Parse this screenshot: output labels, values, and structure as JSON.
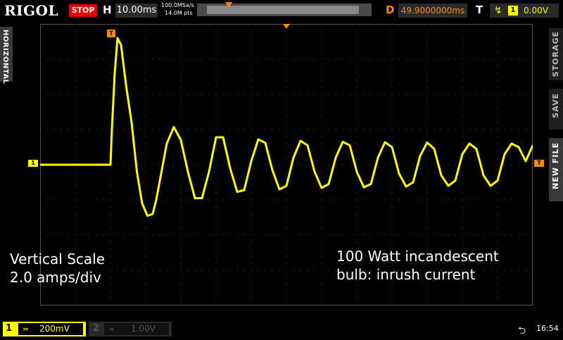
{
  "header": {
    "brand": "RIGOL",
    "run_state": "STOP",
    "horizontal_label": "H",
    "timebase": "10.00ms",
    "sample_rate": "100.0MSa/s",
    "memory_depth": "14.0M pts",
    "delay_label": "D",
    "delay": "49.9000000ms",
    "trigger_label": "T",
    "trigger_channel": "1",
    "trigger_level": "0.00V",
    "trigger_edge_icon": "rising-edge-icon"
  },
  "side": {
    "left_tab": "HORIZONTAL",
    "right_tabs": [
      "STORAGE",
      "SAVE",
      "NEW FILE"
    ]
  },
  "markers": {
    "ch1": "1",
    "trigger_pos": "T",
    "trigger_level": "T"
  },
  "annotations": {
    "left_line1": "Vertical Scale",
    "left_line2": "2.0 amps/div",
    "right_line1": "100 Watt incandescent",
    "right_line2": "bulb: inrush current"
  },
  "footer": {
    "ch1_number": "1",
    "ch1_coupling": "=",
    "ch1_scale": "200mV",
    "ch2_number": "2",
    "ch2_coupling": "=",
    "ch2_scale": "1.00V",
    "usb_icon": "usb-icon",
    "time": "16:54"
  },
  "colors": {
    "ch1": "#ffff00",
    "trigger": "#ff8c00",
    "stop": "#e80000",
    "grid": "#555555"
  },
  "chart_data": {
    "type": "line",
    "grid": {
      "divisions_x": 14,
      "divisions_y": 8,
      "visible": true
    },
    "series": [
      {
        "channel": "1",
        "x_div": [
          0,
          2.0,
          2.04,
          2.12,
          2.2,
          2.3,
          2.45,
          2.6,
          2.75,
          2.9,
          3.05,
          3.2,
          3.3,
          3.45,
          3.6,
          3.8,
          4.0,
          4.2,
          4.4,
          4.6,
          4.8,
          5.0,
          5.2,
          5.4,
          5.6,
          5.8,
          6.0,
          6.2,
          6.4,
          6.6,
          6.8,
          7.0,
          7.2,
          7.4,
          7.6,
          7.8,
          8.0,
          8.2,
          8.4,
          8.6,
          8.8,
          9.0,
          9.2,
          9.4,
          9.6,
          9.8,
          10.0,
          10.2,
          10.4,
          10.6,
          10.8,
          11.0,
          11.2,
          11.4,
          11.6,
          11.8,
          12.0,
          12.2,
          12.4,
          12.6,
          12.8,
          13.0,
          13.2,
          13.4,
          13.6,
          13.8,
          14.0
        ],
        "y_div": [
          0,
          0,
          1.0,
          2.6,
          3.6,
          3.4,
          2.2,
          1.2,
          -0.2,
          -1.1,
          -1.45,
          -1.4,
          -1.0,
          -0.2,
          0.6,
          1.07,
          0.7,
          -0.2,
          -0.95,
          -0.95,
          -0.2,
          0.78,
          0.78,
          -0.1,
          -0.77,
          -0.72,
          0.1,
          0.72,
          0.62,
          -0.15,
          -0.7,
          -0.6,
          0.2,
          0.68,
          0.55,
          -0.2,
          -0.66,
          -0.55,
          0.2,
          0.65,
          0.55,
          -0.2,
          -0.64,
          -0.55,
          0.2,
          0.64,
          0.5,
          -0.25,
          -0.62,
          -0.5,
          0.25,
          0.63,
          0.45,
          -0.3,
          -0.6,
          -0.45,
          0.3,
          0.6,
          0.45,
          -0.3,
          -0.6,
          -0.45,
          0.3,
          0.6,
          0.5,
          0.1,
          0.55
        ]
      }
    ]
  }
}
